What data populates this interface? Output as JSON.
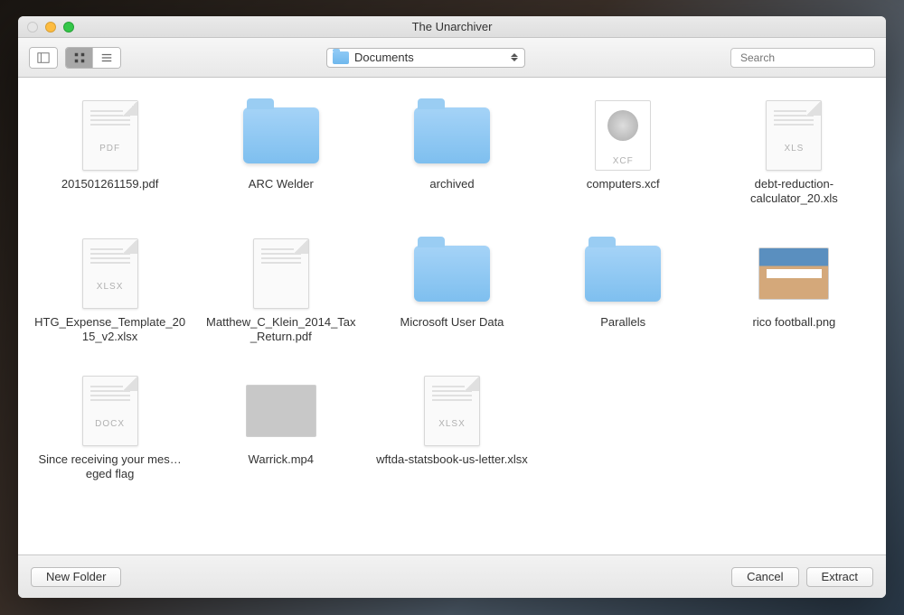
{
  "window": {
    "title": "The Unarchiver"
  },
  "toolbar": {
    "location_label": "Documents",
    "search_placeholder": "Search"
  },
  "items": [
    {
      "label": "201501261159.pdf",
      "tag": "PDF",
      "kind": "doc"
    },
    {
      "label": "ARC Welder",
      "kind": "folder"
    },
    {
      "label": "archived",
      "kind": "folder"
    },
    {
      "label": "computers.xcf",
      "tag": "XCF",
      "kind": "xcf"
    },
    {
      "label": "debt-reduction-calculator_20.xls",
      "tag": "XLS",
      "kind": "doc"
    },
    {
      "label": "HTG_Expense_Template_2015_v2.xlsx",
      "tag": "XLSX",
      "kind": "doc"
    },
    {
      "label": "Matthew_C_Klein_2014_Tax_Return.pdf",
      "tag": "",
      "kind": "doc"
    },
    {
      "label": "Microsoft User Data",
      "kind": "folder"
    },
    {
      "label": "Parallels",
      "kind": "folder"
    },
    {
      "label": "rico football.png",
      "kind": "thumb-meme"
    },
    {
      "label": "Since receiving your mes…eged flag",
      "tag": "DOCX",
      "kind": "doc"
    },
    {
      "label": "Warrick.mp4",
      "kind": "thumb"
    },
    {
      "label": "wftda-statsbook-us-letter.xlsx",
      "tag": "XLSX",
      "kind": "doc"
    }
  ],
  "footer": {
    "new_folder": "New Folder",
    "cancel": "Cancel",
    "extract": "Extract"
  }
}
